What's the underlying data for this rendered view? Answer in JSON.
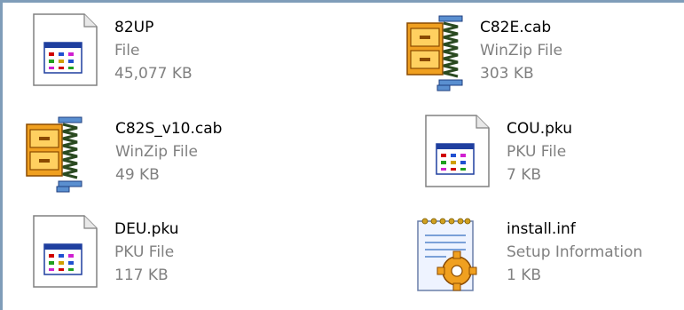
{
  "files": [
    {
      "name": "82UP",
      "type": "File",
      "size": "45,077 KB",
      "icon": "application-window-icon"
    },
    {
      "name": "C82E.cab",
      "type": "WinZip File",
      "size": "303 KB",
      "icon": "winzip-cabinet-icon"
    },
    {
      "name": "C82S_v10.cab",
      "type": "WinZip File",
      "size": "49 KB",
      "icon": "winzip-cabinet-icon"
    },
    {
      "name": "COU.pku",
      "type": "PKU File",
      "size": "7 KB",
      "icon": "application-window-icon"
    },
    {
      "name": "DEU.pku",
      "type": "PKU File",
      "size": "117 KB",
      "icon": "application-window-icon"
    },
    {
      "name": "install.inf",
      "type": "Setup Information",
      "size": "1 KB",
      "icon": "setup-information-icon"
    }
  ]
}
